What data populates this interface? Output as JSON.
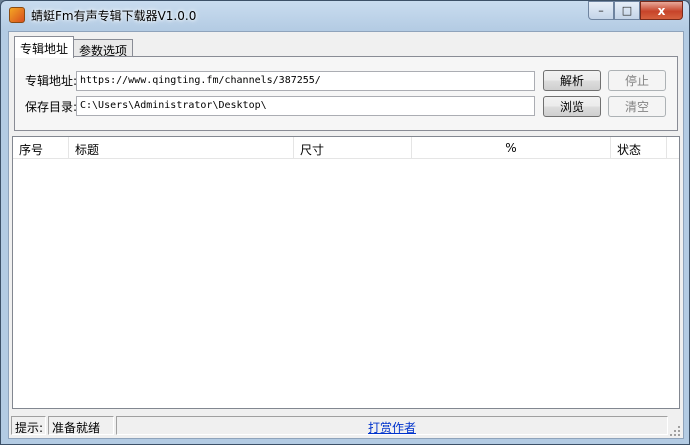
{
  "window": {
    "title": "蜻蜓Fm有声专辑下载器V1.0.0",
    "buttons": {
      "minimize": "–",
      "maximize": "□",
      "close": "x"
    }
  },
  "tabs": [
    {
      "label": "专辑地址",
      "active": true
    },
    {
      "label": "参数选项",
      "active": false
    }
  ],
  "form": {
    "album_url": {
      "label": "专辑地址:",
      "value": "https://www.qingting.fm/channels/387255/"
    },
    "save_dir": {
      "label": "保存目录:",
      "value": "C:\\Users\\Administrator\\Desktop\\"
    },
    "buttons": {
      "parse": {
        "label": "解析",
        "enabled": true
      },
      "stop": {
        "label": "停止",
        "enabled": false
      },
      "browse": {
        "label": "浏览",
        "enabled": true
      },
      "clear": {
        "label": "清空",
        "enabled": false
      }
    }
  },
  "table": {
    "columns": [
      "序号",
      "标题",
      "尺寸",
      "%",
      "状态"
    ],
    "rows": []
  },
  "statusbar": {
    "hint_label": "提示:",
    "status_text": "准备就绪",
    "donate_link": "打赏作者"
  },
  "colors": {
    "title_bar": "#b3cbe3",
    "close_button": "#c7442a",
    "link": "#0033cc"
  }
}
